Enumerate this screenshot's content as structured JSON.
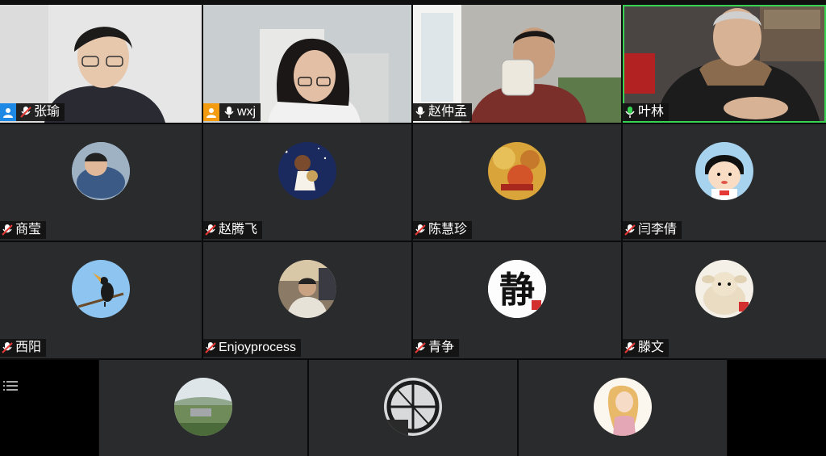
{
  "participants": [
    {
      "name": "张瑜",
      "badge": "user",
      "mic": "muted",
      "video": true
    },
    {
      "name": "wxj",
      "badge": "user-orange",
      "mic": "on",
      "video": true
    },
    {
      "name": "赵仲孟",
      "badge": "",
      "mic": "on",
      "video": true
    },
    {
      "name": "叶林",
      "badge": "",
      "mic": "active",
      "video": true
    },
    {
      "name": "商莹",
      "mic": "muted"
    },
    {
      "name": "赵腾飞",
      "mic": "muted"
    },
    {
      "name": "陈慧珍",
      "mic": "muted"
    },
    {
      "name": "闫李倩",
      "mic": "muted"
    },
    {
      "name": "西阳",
      "mic": "muted"
    },
    {
      "name": "Enjoyprocess",
      "mic": "muted"
    },
    {
      "name": "青争",
      "mic": "muted"
    },
    {
      "name": "滕文",
      "mic": "muted"
    },
    {
      "name": "",
      "mic": ""
    },
    {
      "name": "",
      "mic": ""
    },
    {
      "name": "",
      "mic": ""
    }
  ],
  "avatar_glyphs": {
    "jing": "静"
  },
  "colors": {
    "tile_bg": "#2a2b2d",
    "active_speaker": "#39d353",
    "host_badge": "#1e88e5",
    "user_badge_orange": "#f39c12",
    "muted_red": "#e53935"
  }
}
